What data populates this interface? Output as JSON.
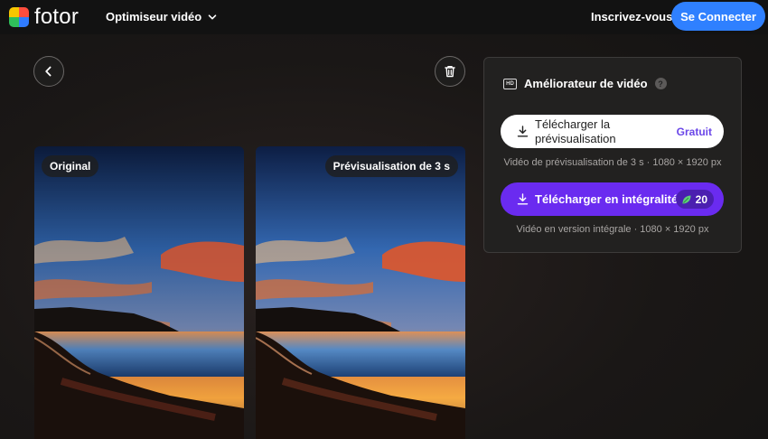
{
  "header": {
    "logo_text": "fotor",
    "tool_menu_label": "Optimiseur vidéo",
    "signup_label": "Inscrivez-vous",
    "login_label": "Se Connecter"
  },
  "previews": {
    "original_tag": "Original",
    "enhanced_tag": "Prévisualisation de 3 s"
  },
  "panel": {
    "hd_badge": "HD",
    "title": "Améliorateur de vidéo",
    "help_glyph": "?",
    "preview_download_label": "Télécharger la prévisualisation",
    "preview_download_badge": "Gratuit",
    "preview_info": "Vidéo de prévisualisation de 3 s · 1080 × 1920 px",
    "full_download_label": "Télécharger en intégralité",
    "full_download_credits": "20",
    "full_info": "Vidéo en version intégrale · 1080 × 1920 px"
  },
  "colors": {
    "accent_blue": "#2f80ff",
    "accent_purple": "#6a2bf0",
    "free_text": "#6a46e8"
  },
  "icons": [
    "fotor-logo-icon",
    "chevron-down-icon",
    "back-arrow-icon",
    "trash-icon",
    "hd-icon",
    "help-icon",
    "download-icon",
    "leaf-credit-icon"
  ]
}
